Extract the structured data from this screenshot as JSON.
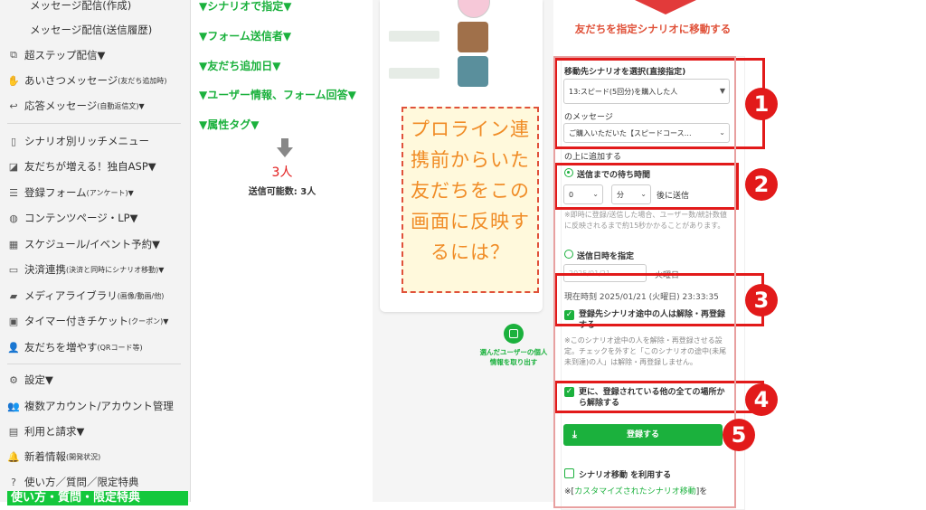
{
  "sidebar": {
    "sub_items": [
      "メッセージ配信(作成)",
      "メッセージ配信(送信履歴)"
    ],
    "items": [
      {
        "icon": "sitemap-icon",
        "label": "超ステップ配信▼",
        "note": ""
      },
      {
        "icon": "hand-icon",
        "label": "あいさつメッセージ",
        "note": "(友だち追加時)"
      },
      {
        "icon": "reply-icon",
        "label": "応答メッセージ",
        "note": "(自動返信文)▼"
      },
      {
        "icon": "mobile-icon",
        "label": "シナリオ別リッチメニュー",
        "note": ""
      },
      {
        "icon": "megaphone-icon",
        "label": "友だちが増える！独自ASP▼",
        "note": ""
      },
      {
        "icon": "list-icon",
        "label": "登録フォーム",
        "note": "(アンケート)▼"
      },
      {
        "icon": "globe-icon",
        "label": "コンテンツページ・LP▼",
        "note": ""
      },
      {
        "icon": "calendar-icon",
        "label": "スケジュール/イベント予約▼",
        "note": ""
      },
      {
        "icon": "credit-card-icon",
        "label": "決済連携",
        "note": "(決済と同時にシナリオ移動)▼"
      },
      {
        "icon": "folder-icon",
        "label": "メディアライブラリ",
        "note": "(画像/動画/他)"
      },
      {
        "icon": "ticket-icon",
        "label": "タイマー付きチケット",
        "note": "(クーポン)▼"
      },
      {
        "icon": "user-plus-icon",
        "label": "友だちを増やす",
        "note": "(QRコード等)"
      },
      {
        "icon": "gear-icon",
        "label": "設定▼",
        "note": ""
      },
      {
        "icon": "users-icon",
        "label": "複数アカウント/アカウント管理",
        "note": ""
      },
      {
        "icon": "billing-icon",
        "label": "利用と請求▼",
        "note": ""
      },
      {
        "icon": "bell-icon",
        "label": "新着情報",
        "note": "(開発状況)"
      },
      {
        "icon": "question-icon",
        "label": "使い方／質問／限定特典",
        "note": ""
      }
    ],
    "banner": "使い方・質問・限定特典"
  },
  "filters": {
    "items": [
      "▼シナリオで指定▼",
      "▼フォーム送信者▼",
      "▼友だち追加日▼",
      "▼ユーザー情報、フォーム回答▼",
      "▼属性タグ▼"
    ],
    "count": "3人",
    "sendable": "送信可能数: 3人"
  },
  "users": {
    "question": "プロライン連携前からいた友だちをこの画面に反映するには？",
    "extract_label": "選んだユーザーの個人情報を取り出す"
  },
  "action": {
    "title": "友だちを指定シナリオに移動する",
    "select_label": "移動先シナリオを選択(直接指定)",
    "scenario_value": "13:スピード(5回分)を購入した人",
    "message_label": "のメッセージ",
    "message_value": "ご購入いただいた【スピードコース…",
    "message_suffix": "の上に追加する",
    "wait_label": "送信までの待ち時間",
    "wait_days": "0",
    "wait_unit": "分",
    "wait_after": "後に送信",
    "wait_note": "※即時に登録/送信した場合、ユーザー数/統計数値に反映されるまで約15秒かかることがあります。",
    "datetime_label": "送信日時を指定",
    "date_value": "2025/01/21",
    "weekday": "火曜日",
    "now_label": "現在時刻 2025/01/21 (火曜日) 23:33:35",
    "cancel_label": "登録先シナリオ途中の人は解除・再登録する",
    "cancel_note": "※このシナリオ途中の人を解除・再登録させる設定。チェックを外すと「このシナリオの途中(未尾未到達)の人」は解除・再登録しません。",
    "cancel_all_label": "更に、登録されている他の全ての場所から解除する",
    "register_button": "登録する",
    "scenario_move_label": "シナリオ移動 を利用する",
    "footer_note_prefix": "※[",
    "footer_link": "カスタマイズされたシナリオ移動",
    "footer_note_suffix": "]を"
  },
  "annotations": [
    "1",
    "2",
    "3",
    "4",
    "5"
  ],
  "colors": {
    "green": "#1bb13d",
    "red": "#e21a1a",
    "orange": "#f08c26"
  }
}
